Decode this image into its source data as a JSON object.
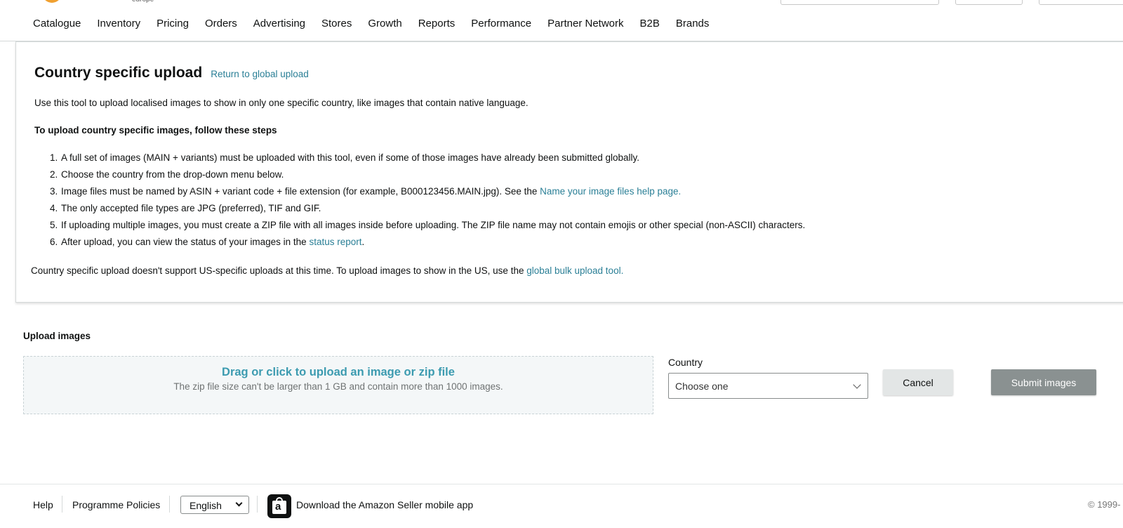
{
  "header": {
    "logo_subtext": "europe"
  },
  "nav": {
    "items": [
      {
        "label": "Catalogue"
      },
      {
        "label": "Inventory"
      },
      {
        "label": "Pricing"
      },
      {
        "label": "Orders"
      },
      {
        "label": "Advertising"
      },
      {
        "label": "Stores"
      },
      {
        "label": "Growth"
      },
      {
        "label": "Reports"
      },
      {
        "label": "Performance"
      },
      {
        "label": "Partner Network"
      },
      {
        "label": "B2B"
      },
      {
        "label": "Brands"
      }
    ]
  },
  "panel": {
    "title": "Country specific upload",
    "return_link": "Return to global upload",
    "intro": "Use this tool to upload localised images to show in only one specific country, like images that contain native language.",
    "steps_title": "To upload country specific images, follow these steps",
    "steps": [
      {
        "num": "1.",
        "text": "A full set of images (MAIN + variants) must be uploaded with this tool, even if some of those images have already been submitted globally."
      },
      {
        "num": "2.",
        "text": "Choose the country from the drop-down menu below."
      },
      {
        "num": "3.",
        "text": "Image files must be named by ASIN + variant code + file extension (for example, B000123456.MAIN.jpg). See the ",
        "link": "Name your image files help page."
      },
      {
        "num": "4.",
        "text": "The only accepted file types are JPG (preferred), TIF and GIF."
      },
      {
        "num": "5.",
        "text": "If uploading multiple images, you must create a ZIP file with all images inside before uploading. The ZIP file name may not contain emojis or other special (non-ASCII) characters."
      },
      {
        "num": "6.",
        "text": "After upload, you can view the status of your images in the ",
        "link": "status report",
        "suffix": "."
      }
    ],
    "note": "Country specific upload doesn't support US-specific uploads at this time. To upload images to show in the US, use the ",
    "note_link": "global bulk upload tool."
  },
  "upload": {
    "heading": "Upload images",
    "dropzone_title": "Drag or click to upload an image or zip file",
    "dropzone_subtitle": "The zip file size can't be larger than 1 GB and contain more than 1000 images.",
    "country_label": "Country",
    "country_value": "Choose one",
    "cancel_label": "Cancel",
    "submit_label": "Submit images"
  },
  "footer": {
    "help": "Help",
    "policies": "Programme Policies",
    "language": "English",
    "app_text": "Download the Amazon Seller mobile app",
    "copyright": "© 1999-"
  },
  "colors": {
    "link": "#2a7f96",
    "dropzone_text": "#3c9bb0",
    "submit_bg": "#8a9191",
    "cancel_bg": "#e3e6e6"
  }
}
